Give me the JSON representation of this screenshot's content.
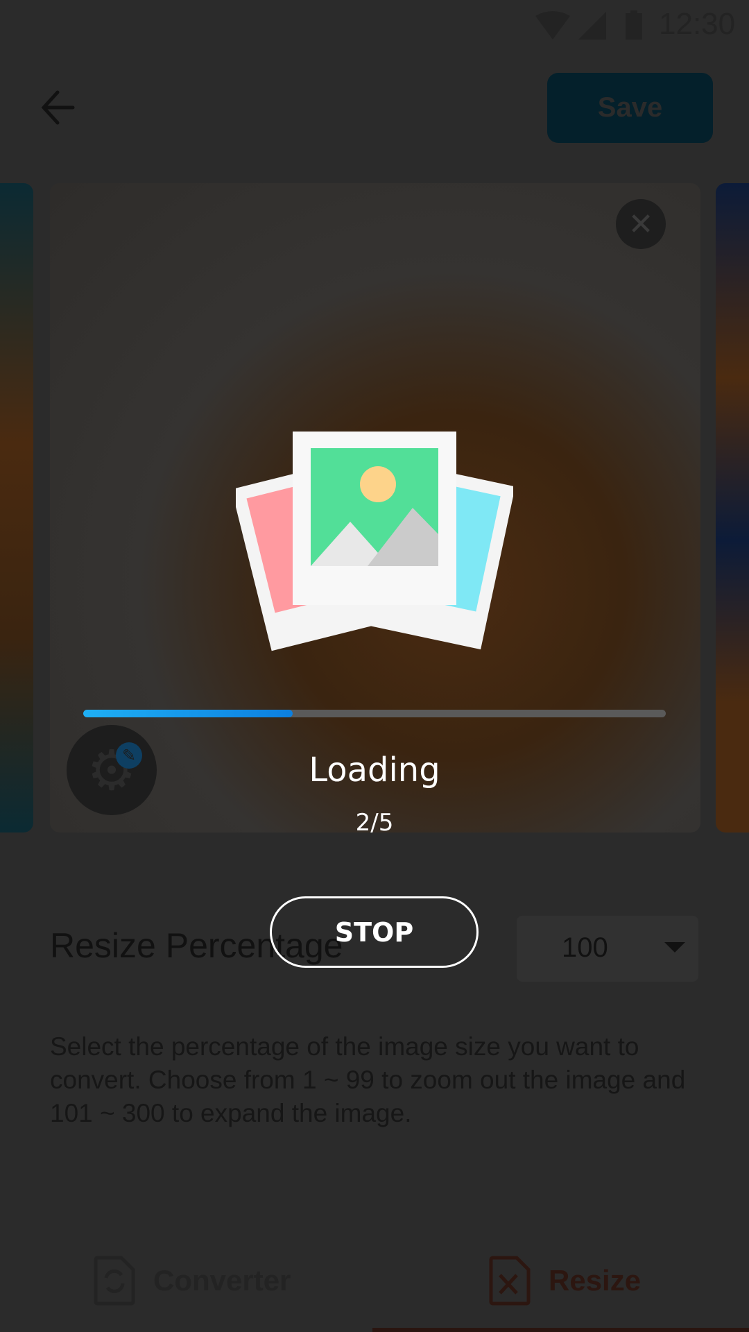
{
  "status_bar": {
    "time": "12:30"
  },
  "header": {
    "save_label": "Save"
  },
  "loading_dialog": {
    "title": "Loading",
    "count": "2/5",
    "progress": 0.36,
    "stop_label": "STOP"
  },
  "resize": {
    "title": "Resize Percentage",
    "selected_value": "100",
    "description": "Select the percentage of the image size you want to convert. Choose from 1 ~ 99 to zoom out the image and 101 ~ 300 to expand the image."
  },
  "bottom_nav": {
    "items": [
      {
        "label": "Converter"
      },
      {
        "label": "Resize"
      }
    ],
    "active": "Resize"
  },
  "colors": {
    "accent": "#1fb0f5",
    "save_bg": "#04202b",
    "resize_accent": "#2c1610"
  }
}
